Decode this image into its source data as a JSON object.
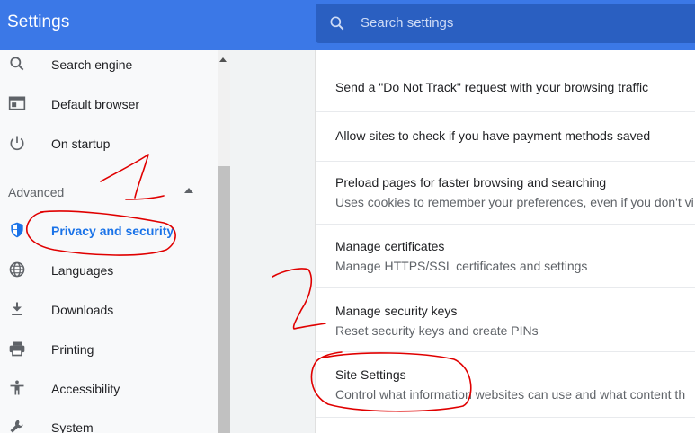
{
  "header": {
    "title": "Settings",
    "search_placeholder": "Search settings",
    "search_icon": "search-icon"
  },
  "sidebar": {
    "items": [
      {
        "label": "Search engine",
        "icon": "search-icon"
      },
      {
        "label": "Default browser",
        "icon": "browser-icon"
      },
      {
        "label": "On startup",
        "icon": "power-icon"
      }
    ],
    "advanced_label": "Advanced",
    "advanced_items": [
      {
        "label": "Privacy and security",
        "icon": "shield-icon",
        "active": true
      },
      {
        "label": "Languages",
        "icon": "globe-icon"
      },
      {
        "label": "Downloads",
        "icon": "download-icon"
      },
      {
        "label": "Printing",
        "icon": "printer-icon"
      },
      {
        "label": "Accessibility",
        "icon": "accessibility-icon"
      },
      {
        "label": "System",
        "icon": "wrench-icon"
      }
    ]
  },
  "main": {
    "rows": [
      {
        "title": "Send a \"Do Not Track\" request with your browsing traffic"
      },
      {
        "title": "Allow sites to check if you have payment methods saved"
      },
      {
        "title": "Preload pages for faster browsing and searching",
        "subtitle": "Uses cookies to remember your preferences, even if you don't vi"
      },
      {
        "title": "Manage certificates",
        "subtitle": "Manage HTTPS/SSL certificates and settings"
      },
      {
        "title": "Manage security keys",
        "subtitle": "Reset security keys and create PINs"
      },
      {
        "title": "Site Settings",
        "subtitle": "Control what information websites can use and what content th"
      }
    ]
  },
  "annotations": {
    "mark_1": "1",
    "mark_2": "2",
    "color": "#e00000"
  },
  "colors": {
    "header": "#3b78e7",
    "search_box": "#2a5fc1",
    "active": "#1a73e8"
  }
}
